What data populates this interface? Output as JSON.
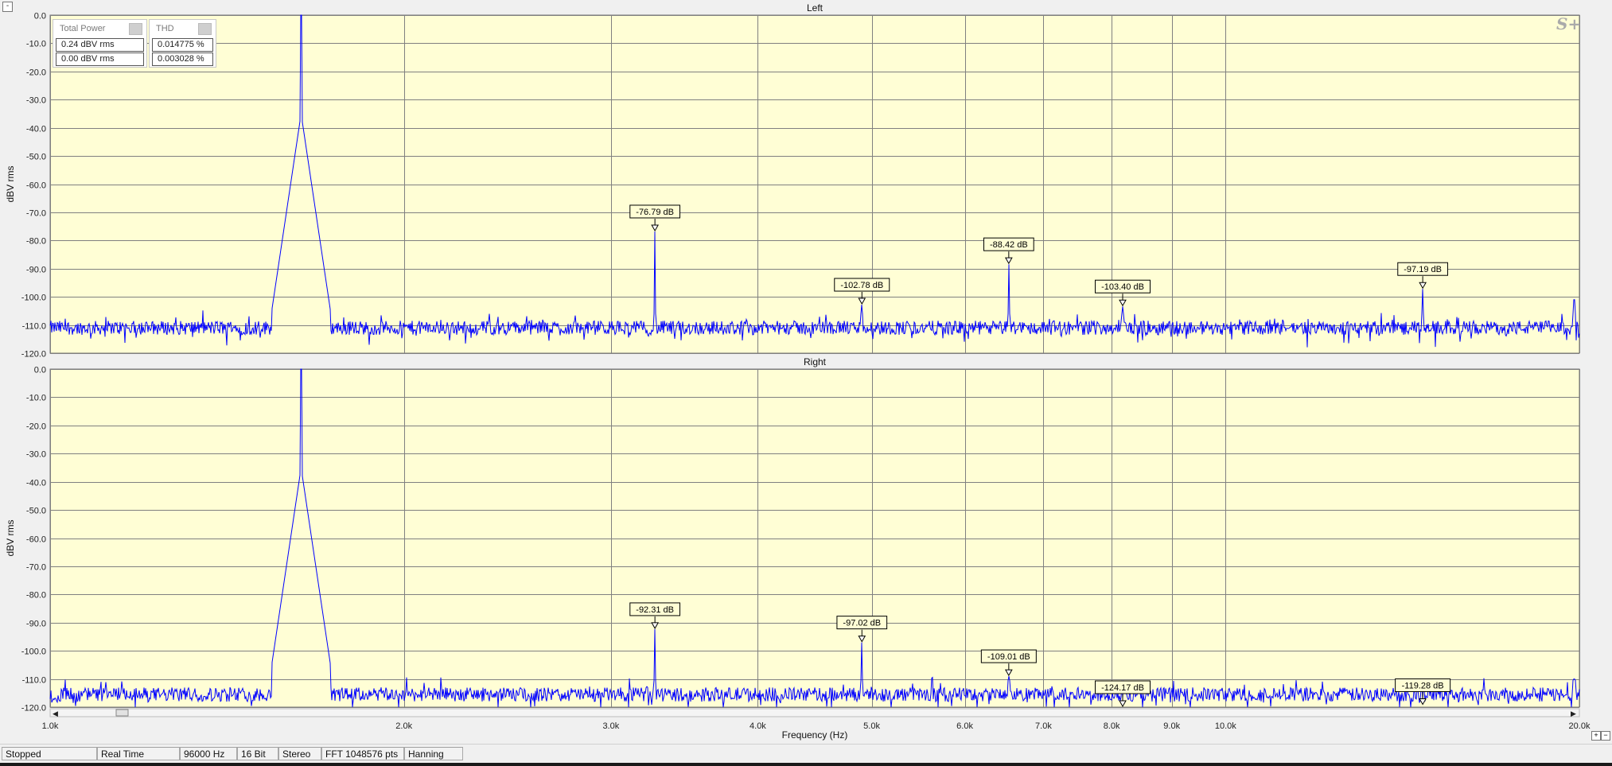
{
  "collapse_symbol": "-",
  "logo": "S+",
  "measurements": {
    "total_power": {
      "label": "Total Power",
      "values": [
        "0.24 dBV rms",
        "0.00 dBV rms"
      ]
    },
    "thd": {
      "label": "THD",
      "values": [
        "0.014775 %",
        "0.003028 %"
      ]
    }
  },
  "status": {
    "state": "Stopped",
    "mode": "Real Time",
    "sample_rate": "96000 Hz",
    "bit_depth": "16 Bit",
    "channels": "Stereo",
    "fft": "FFT 1048576 pts",
    "window": "Hanning"
  },
  "colors": {
    "plot_bg": "#fffed5",
    "trace": "#0000ff",
    "grid": "#808080"
  },
  "chart_data": [
    {
      "type": "line",
      "title": "Left",
      "ylabel": "dBV rms",
      "xlabel": "",
      "x_scale": "log",
      "xlim": [
        1000,
        20000
      ],
      "ylim": [
        -120,
        0
      ],
      "grid": true,
      "x_ticks": [
        1000,
        2000,
        3000,
        4000,
        5000,
        6000,
        7000,
        8000,
        9000,
        10000,
        20000
      ],
      "x_tick_labels": [
        "1.0k",
        "2.0k",
        "3.0k",
        "4.0k",
        "5.0k",
        "6.0k",
        "7.0k",
        "8.0k",
        "9.0k",
        "10.0k",
        "20.0k"
      ],
      "y_ticks": [
        0,
        -10,
        -20,
        -30,
        -40,
        -50,
        -60,
        -70,
        -80,
        -90,
        -100,
        -110,
        -120
      ],
      "y_tick_labels": [
        "0.0",
        "-10.0",
        "-20.0",
        "-30.0",
        "-40.0",
        "-50.0",
        "-60.0",
        "-70.0",
        "-80.0",
        "-90.0",
        "-100.0",
        "-110.0",
        "-120.0"
      ],
      "noise_floor": -111,
      "peaks": [
        {
          "x": 1635,
          "y": 0
        },
        {
          "x": 3270,
          "y": -76.79,
          "label": "-76.79 dB"
        },
        {
          "x": 4905,
          "y": -102.78,
          "label": "-102.78 dB"
        },
        {
          "x": 6540,
          "y": -88.42,
          "label": "-88.42 dB"
        },
        {
          "x": 8175,
          "y": -103.4,
          "label": "-103.40 dB"
        },
        {
          "x": 14715,
          "y": -97.19,
          "label": "-97.19 dB"
        },
        {
          "x": 19800,
          "y": -101
        }
      ]
    },
    {
      "type": "line",
      "title": "Right",
      "ylabel": "dBV rms",
      "xlabel": "Frequency (Hz)",
      "x_scale": "log",
      "xlim": [
        1000,
        20000
      ],
      "ylim": [
        -120,
        0
      ],
      "grid": true,
      "x_ticks": [
        1000,
        2000,
        3000,
        4000,
        5000,
        6000,
        7000,
        8000,
        9000,
        10000,
        20000
      ],
      "x_tick_labels": [
        "1.0k",
        "2.0k",
        "3.0k",
        "4.0k",
        "5.0k",
        "6.0k",
        "7.0k",
        "8.0k",
        "9.0k",
        "10.0k",
        "20.0k"
      ],
      "y_ticks": [
        0,
        -10,
        -20,
        -30,
        -40,
        -50,
        -60,
        -70,
        -80,
        -90,
        -100,
        -110,
        -120
      ],
      "y_tick_labels": [
        "0.0",
        "-10.0",
        "-20.0",
        "-30.0",
        "-40.0",
        "-50.0",
        "-60.0",
        "-70.0",
        "-80.0",
        "-90.0",
        "-100.0",
        "-110.0",
        "-120.0"
      ],
      "noise_floor": -115.5,
      "peaks": [
        {
          "x": 1635,
          "y": 0
        },
        {
          "x": 3270,
          "y": -92.31,
          "label": "-92.31 dB"
        },
        {
          "x": 4905,
          "y": -97.02,
          "label": "-97.02 dB"
        },
        {
          "x": 6540,
          "y": -109.01,
          "label": "-109.01 dB"
        },
        {
          "x": 8175,
          "y": -124.17,
          "label": "-124.17 dB"
        },
        {
          "x": 14715,
          "y": -119.28,
          "label": "-119.28 dB"
        },
        {
          "x": 19800,
          "y": -110
        }
      ]
    }
  ]
}
